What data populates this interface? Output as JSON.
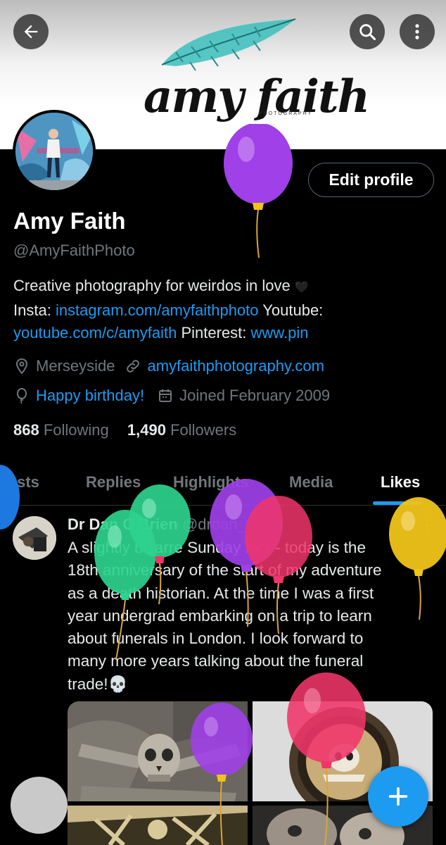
{
  "header": {
    "logo_text": "amy faith",
    "logo_subtext": "PHOTOGRAPHY",
    "icons": [
      "arrow-left-icon",
      "search-icon",
      "more-vertical-icon"
    ]
  },
  "profile": {
    "edit_label": "Edit profile",
    "name": "Amy Faith",
    "handle": "@AmyFaithPhoto",
    "bio": {
      "line1": "Creative photography for weirdos in love",
      "heart": "🖤",
      "insta_label": "Insta:",
      "insta_link": "instagram.com/amyfaithphoto",
      "youtube_label": "Youtube:",
      "youtube_link": "youtube.com/c/amyfaith",
      "pinterest_label": "Pinterest:",
      "pinterest_link": "www.pin"
    },
    "location": "Merseyside",
    "website": "amyfaithphotography.com",
    "birthday": "Happy birthday!",
    "joined": "Joined February 2009",
    "following_count": "868",
    "following_label": "Following",
    "followers_count": "1,490",
    "followers_label": "Followers"
  },
  "tabs": {
    "items": [
      "Posts",
      "Replies",
      "Highlights",
      "Media",
      "Likes"
    ],
    "active": "Likes"
  },
  "tweet": {
    "display_name": "Dr Dan O'Brien",
    "handle": "@drdan_world",
    "more": "⋮",
    "lines": [
      "A slightly bizarre Sunday fact - today is the",
      "18th anniversary of the start of my adventure",
      "as a death historian. At the time I was a first",
      "year undergrad embarking on a trip to learn",
      "about funerals in London. I look forward to",
      "many more years talking about the funeral",
      "trade!💀"
    ]
  },
  "fab": {
    "icon": "plus-icon"
  },
  "colors": {
    "accent": "#1d9bf0",
    "background": "#000000",
    "text": "#e7e9ea",
    "muted": "#71767b",
    "balloon_purple": "#a040e8",
    "balloon_green": "#2ed38e",
    "balloon_pink": "#f0356a",
    "balloon_yellow": "#f0c419"
  }
}
